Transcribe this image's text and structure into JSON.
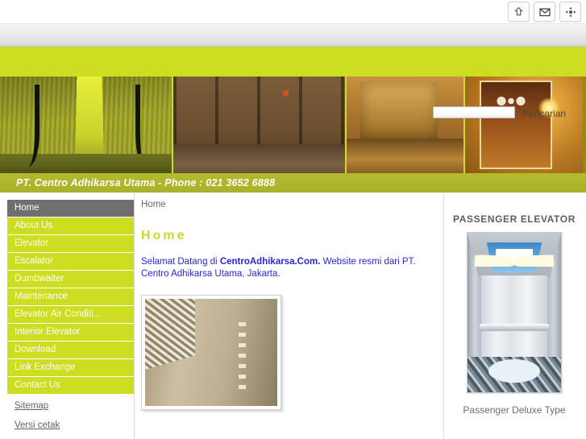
{
  "browser": {
    "buttons": [
      {
        "name": "home-icon",
        "title": "Home"
      },
      {
        "name": "mail-icon",
        "title": "Mail"
      },
      {
        "name": "move-icon",
        "title": "Move"
      }
    ]
  },
  "search": {
    "value": "",
    "placeholder": "",
    "label": "Pencarian"
  },
  "banner": {
    "panes": [
      {
        "name": "escalator-photo",
        "alt": "Escalator"
      },
      {
        "name": "elevator-doors-photo",
        "alt": "Elevator doors"
      },
      {
        "name": "lobby-photo",
        "alt": "Lobby"
      },
      {
        "name": "gold-elevator-photo",
        "alt": "Gold elevator"
      }
    ],
    "company_line": "PT. Centro Adhikarsa Utama - Phone : 021 3652 6888"
  },
  "sidebar": {
    "items": [
      {
        "label": "Home",
        "active": true
      },
      {
        "label": "About Us",
        "active": false
      },
      {
        "label": "Elevator",
        "active": false
      },
      {
        "label": "Escalator",
        "active": false
      },
      {
        "label": "Dumbwaiter",
        "active": false
      },
      {
        "label": "Maintenance",
        "active": false
      },
      {
        "label": "Elevator Air Conditi...",
        "active": false
      },
      {
        "label": "Interior Elevator",
        "active": false
      },
      {
        "label": "Download",
        "active": false
      },
      {
        "label": "Link Exchange",
        "active": false
      },
      {
        "label": "Contact Us",
        "active": false
      }
    ],
    "links": [
      {
        "label": "Sitemap"
      },
      {
        "label": "Versi cetak"
      }
    ]
  },
  "main": {
    "breadcrumb": "Home",
    "title": "Home",
    "intro_lead": "Selamat Datang di ",
    "intro_bold": "CentroAdhikarsa.Com.",
    "intro_tail": " Website resmi dari PT. Centro Adhikarsa Utama, Jakarta.",
    "photo_alt": "Elevator interior photo"
  },
  "right": {
    "title": "PASSENGER ELEVATOR",
    "caption": "Passenger Deluxe Type",
    "image_alt": "Passenger deluxe elevator cabin"
  },
  "colors": {
    "brand_green": "#ccdd22",
    "band_olive": "#a9b12a",
    "active_gray": "#6f6f6f",
    "link_blue": "#2727e0",
    "title_green": "#cbd72c"
  }
}
